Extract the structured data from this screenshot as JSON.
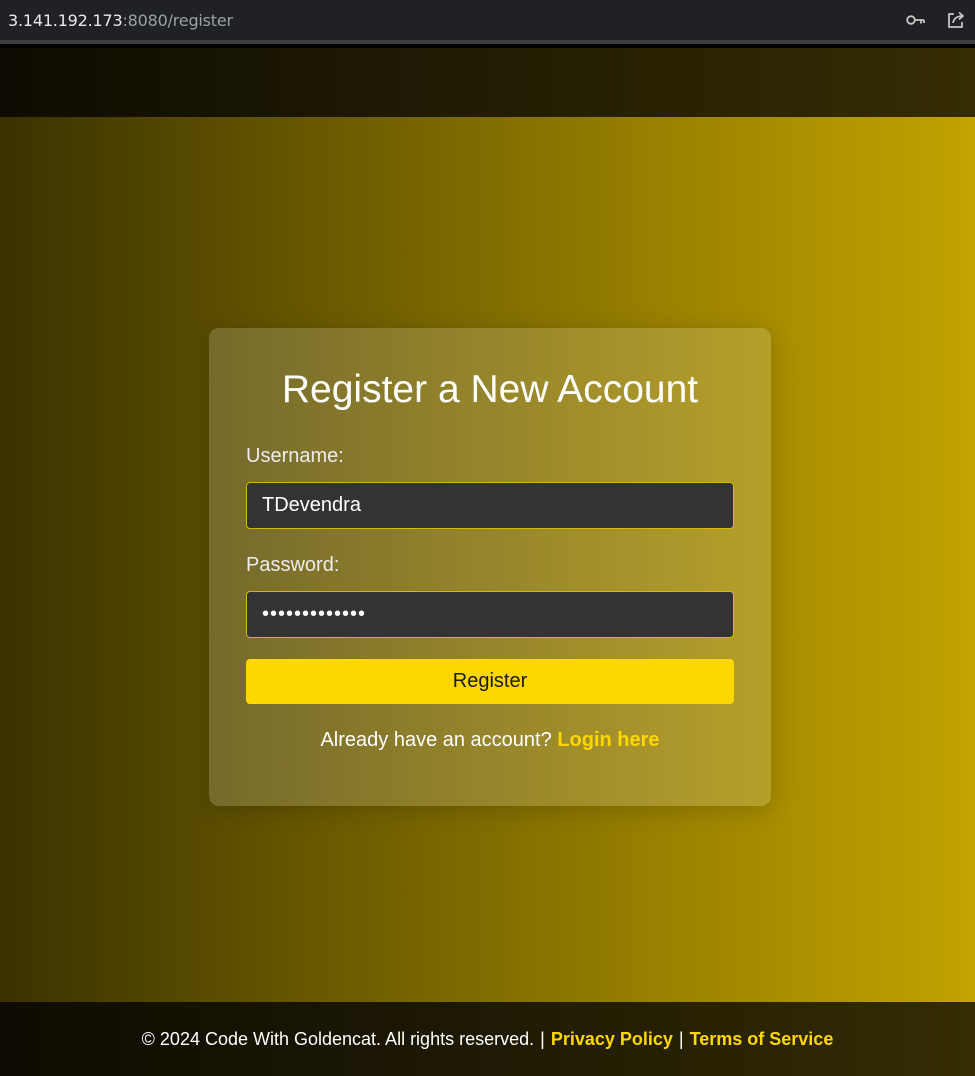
{
  "browser": {
    "url_host": "3.141.192.173",
    "url_path": ":8080/register",
    "icons": [
      "key-icon",
      "share-icon"
    ]
  },
  "form": {
    "title": "Register a New Account",
    "username_label": "Username:",
    "username_value": "TDevendra",
    "password_label": "Password:",
    "password_value": "•••••••••••••",
    "register_label": "Register",
    "login_prompt": "Already have an account?",
    "login_link": "Login here"
  },
  "footer": {
    "copyright": "© 2024 Code With Goldencat. All rights reserved.",
    "separator": "|",
    "privacy": "Privacy Policy",
    "terms": "Terms of Service"
  },
  "colors": {
    "accent": "#ffd700",
    "input_bg": "#333333"
  }
}
